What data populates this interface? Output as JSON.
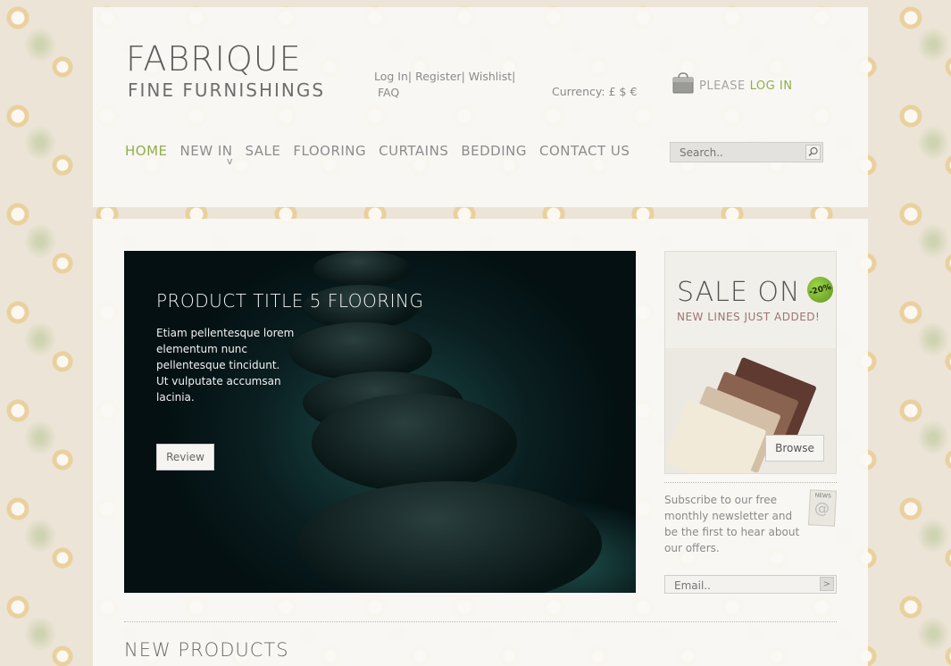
{
  "logo": {
    "title": "FABRIQUE",
    "subtitle": "FINE FURNISHINGS"
  },
  "top_links": {
    "login": "Log In|",
    "register": "Register|",
    "wishlist": "Wishlist|",
    "faq": "FAQ"
  },
  "currency": "Currency: £ $ €",
  "login_prompt": {
    "please": "PLEASE",
    "link": "LOG IN"
  },
  "nav": {
    "items": [
      "HOME",
      "NEW IN",
      "SALE",
      "FLOORING",
      "CURTAINS",
      "BEDDING",
      "CONTACT US"
    ],
    "caret": "v",
    "active_color": "#8fae4a"
  },
  "search": {
    "placeholder": "Search.."
  },
  "hero": {
    "title": "PRODUCT TITLE 5 FLOORING",
    "text": "Etiam pellentesque lorem elementum nunc pellentesque tincidunt. Ut vulputate accumsan lacinia.",
    "button": "Review"
  },
  "sale": {
    "title": "SALE ON",
    "badge": "-20%",
    "subtitle": "NEW LINES JUST ADDED!",
    "button": "Browse"
  },
  "newsletter": {
    "text": "Subscribe to our free monthly newsletter and be the first to hear about our offers.",
    "icon_label": "NEWS",
    "icon_symbol": "@",
    "email_placeholder": "Email..",
    "submit_symbol": ">"
  },
  "section": {
    "new_products": "NEW PRODUCTS"
  }
}
